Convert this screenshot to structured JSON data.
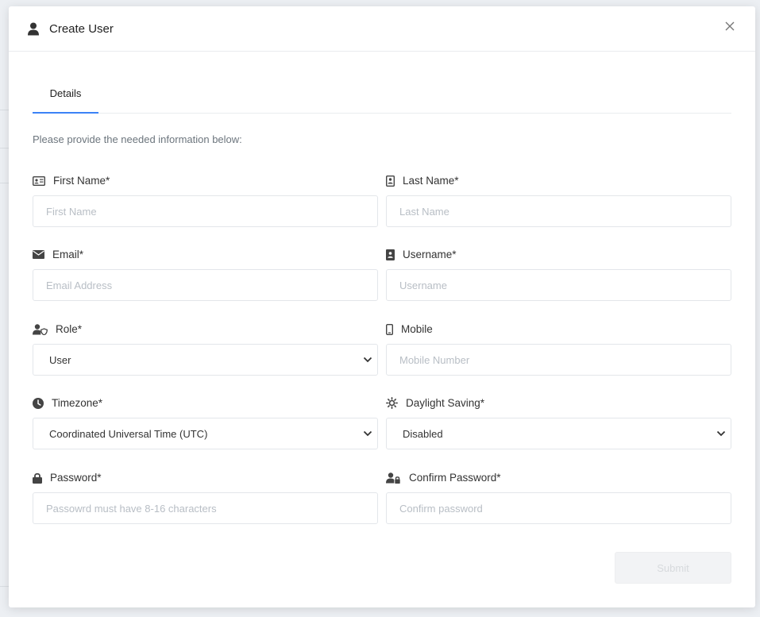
{
  "modal": {
    "title": "Create User",
    "title_icon": "user-icon",
    "close_icon": "close-icon"
  },
  "tabs": [
    {
      "label": "Details",
      "active": true
    }
  ],
  "intro_text": "Please provide the needed information below:",
  "fields": {
    "first_name": {
      "label": "First Name*",
      "placeholder": "First Name",
      "icon": "id-card-icon"
    },
    "last_name": {
      "label": "Last Name*",
      "placeholder": "Last Name",
      "icon": "contact-book-icon"
    },
    "email": {
      "label": "Email*",
      "placeholder": "Email Address",
      "icon": "envelope-icon"
    },
    "username": {
      "label": "Username*",
      "placeholder": "Username",
      "icon": "address-book-icon"
    },
    "role": {
      "label": "Role*",
      "value": "User",
      "icon": "user-shield-icon"
    },
    "mobile": {
      "label": "Mobile",
      "placeholder": "Mobile Number",
      "icon": "mobile-phone-icon"
    },
    "timezone": {
      "label": "Timezone*",
      "value": "Coordinated Universal Time (UTC)",
      "icon": "clock-icon"
    },
    "daylight_saving": {
      "label": "Daylight Saving*",
      "value": "Disabled",
      "icon": "sun-icon"
    },
    "password": {
      "label": "Password*",
      "placeholder": "Passowrd must have 8-16 characters",
      "icon": "lock-icon"
    },
    "confirm_password": {
      "label": "Confirm Password*",
      "placeholder": "Confirm password",
      "icon": "user-lock-icon"
    }
  },
  "submit_label": "Submit",
  "colors": {
    "accent": "#3b82f6",
    "label_text": "#333333",
    "placeholder_text": "#b8bec5",
    "border": "#e3e6ea",
    "submit_disabled_bg": "#f2f3f5"
  }
}
